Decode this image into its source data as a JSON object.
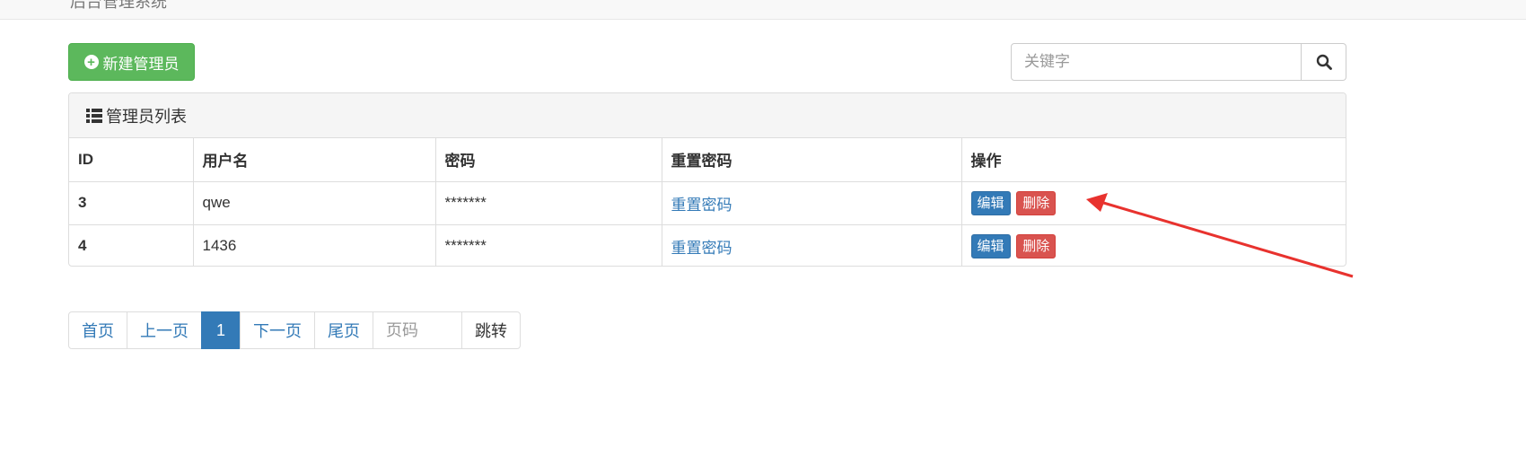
{
  "header": {
    "title": "后台管理系统"
  },
  "toolbar": {
    "new_button_label": "新建管理员",
    "search_placeholder": "关键字",
    "search_icon": "search-icon"
  },
  "panel": {
    "title": "管理员列表",
    "icon": "list-icon"
  },
  "table": {
    "columns": [
      "ID",
      "用户名",
      "密码",
      "重置密码",
      "操作"
    ],
    "rows": [
      {
        "id": "3",
        "username": "qwe",
        "password": "*******",
        "reset_label": "重置密码",
        "edit_label": "编辑",
        "delete_label": "删除"
      },
      {
        "id": "4",
        "username": "1436",
        "password": "*******",
        "reset_label": "重置密码",
        "edit_label": "编辑",
        "delete_label": "删除"
      }
    ]
  },
  "pagination": {
    "first": "首页",
    "prev": "上一页",
    "current": "1",
    "next": "下一页",
    "last": "尾页",
    "page_placeholder": "页码",
    "jump": "跳转"
  },
  "colors": {
    "success": "#5cb85c",
    "primary": "#337ab7",
    "danger": "#d9534f",
    "annotation_arrow": "#e8322e"
  }
}
